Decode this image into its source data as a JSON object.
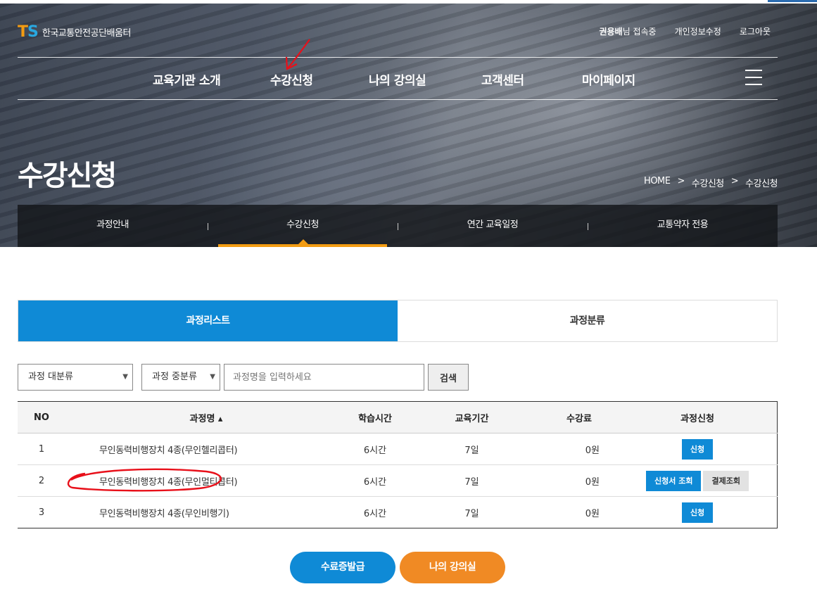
{
  "logo": {
    "mark_t": "T",
    "mark_s": "S",
    "text": "한국교통안전공단배움터"
  },
  "util": {
    "user_name": "권용배",
    "user_suffix": "님 접속중",
    "privacy": "개인정보수정",
    "logout": "로그아웃"
  },
  "gnb": {
    "items": [
      "교육기관 소개",
      "수강신청",
      "나의 강의실",
      "고객센터",
      "마이페이지"
    ]
  },
  "page_title": "수강신청",
  "breadcrumb": [
    "HOME",
    ">",
    "수강신청",
    ">",
    "수강신청"
  ],
  "subnav": {
    "items": [
      "과정안내",
      "수강신청",
      "연간 교육일정",
      "교통약자 전용"
    ],
    "active": 1
  },
  "tabs": {
    "items": [
      "과정리스트",
      "과정분류"
    ],
    "active": 0
  },
  "search": {
    "category1": "과정 대분류",
    "category2": "과정 중분류",
    "caret": "▼",
    "placeholder": "과정명을 입력하세요",
    "button": "검색"
  },
  "table": {
    "headers": [
      "NO",
      "과정명 ▴",
      "학습시간",
      "교육기간",
      "수강료",
      "과정신청"
    ],
    "rows": [
      {
        "no": "1",
        "name": "무인동력비행장치 4종(무인헬리콥터)",
        "hours": "6시간",
        "period": "7일",
        "fee": "0원",
        "actions": [
          "신청"
        ]
      },
      {
        "no": "2",
        "name": "무인동력비행장치 4종(무인멀티콥터)",
        "hours": "6시간",
        "period": "7일",
        "fee": "0원",
        "actions": [
          "신청서 조회",
          "결제조회"
        ]
      },
      {
        "no": "3",
        "name": "무인동력비행장치 4종(무인비행기)",
        "hours": "6시간",
        "period": "7일",
        "fee": "0원",
        "actions": [
          "신청"
        ]
      }
    ]
  },
  "bottom": {
    "certificate": "수료증발급",
    "my_classroom": "나의 강의실"
  },
  "colors": {
    "accent_blue": "#0f8ad6",
    "accent_orange": "#f08a24",
    "annotation_red": "#e8101a"
  }
}
